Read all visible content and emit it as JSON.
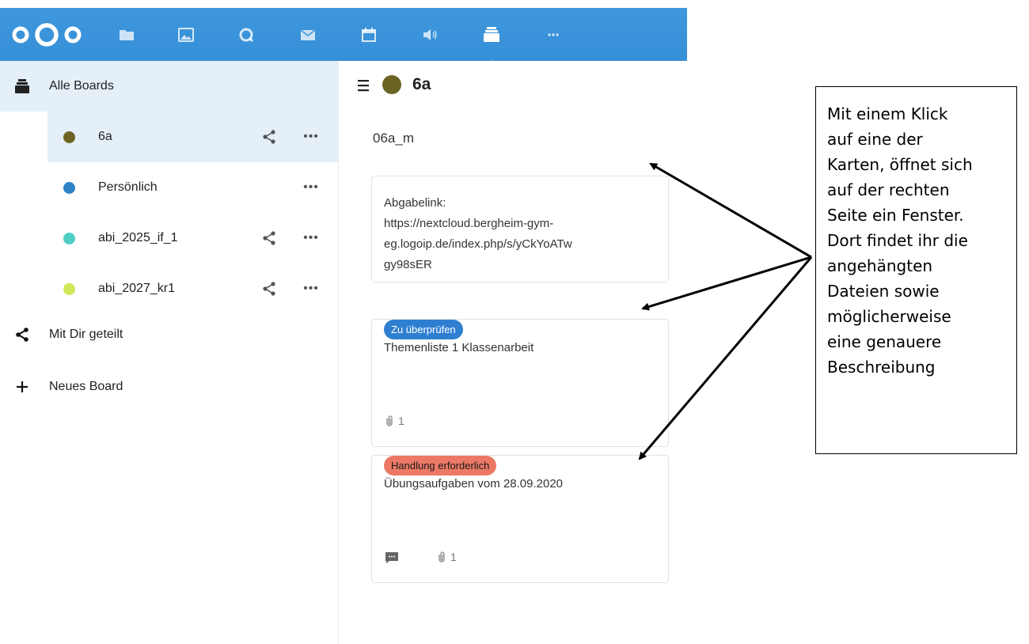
{
  "header": {
    "apps": [
      {
        "name": "files",
        "icon": "folder-icon"
      },
      {
        "name": "photos",
        "icon": "image-icon"
      },
      {
        "name": "activity",
        "icon": "search-icon"
      },
      {
        "name": "mail",
        "icon": "mail-icon"
      },
      {
        "name": "calendar",
        "icon": "calendar-icon"
      },
      {
        "name": "audio",
        "icon": "speaker-icon"
      },
      {
        "name": "deck",
        "icon": "deck-icon"
      },
      {
        "name": "more",
        "icon": "more-apps-icon"
      }
    ],
    "active_app": "deck",
    "bar_color": "#3a93da"
  },
  "sidebar": {
    "all_boards": "Alle Boards",
    "boards": [
      {
        "name": "6a",
        "color": "#6b6423",
        "shared": true,
        "active": true
      },
      {
        "name": "Persönlich",
        "color": "#2e84c9",
        "shared": false
      },
      {
        "name": "abi_2025_if_1",
        "color": "#4fcfc6",
        "shared": true
      },
      {
        "name": "abi_2027_kr1",
        "color": "#cfe857",
        "shared": true
      }
    ],
    "shared_with_me": "Mit Dir geteilt",
    "new_board": "Neues Board"
  },
  "main": {
    "board_title": "6a",
    "board_color": "#6b6423",
    "stack_title": "06a_m",
    "cards": [
      {
        "lines": [
          "Abgabelink:",
          "https://nextcloud.bergheim-gym-",
          "eg.logoip.de/index.php/s/yCkYoATw",
          "gy98sER"
        ]
      },
      {
        "title": "Themenliste 1 Klassenarbeit",
        "label": "Zu überprüfen",
        "label_bg": "#2f7fd1",
        "label_fg": "#ffffff",
        "attachments": "1"
      },
      {
        "title": "Übungsaufgaben vom 28.09.2020",
        "label": "Handlung erforderlich",
        "label_bg": "#ec7966",
        "label_fg": "#1a1a1a",
        "attachments": "1",
        "has_comments": true
      }
    ]
  },
  "annotation": {
    "lines": [
      "Mit einem Klick",
      "auf eine der",
      "Karten, öffnet sich",
      "auf der rechten",
      "Seite ein Fenster.",
      "Dort findet ihr die",
      "angehängten",
      "Dateien sowie",
      "möglicherweise",
      "eine genauere",
      "Beschreibung"
    ]
  }
}
